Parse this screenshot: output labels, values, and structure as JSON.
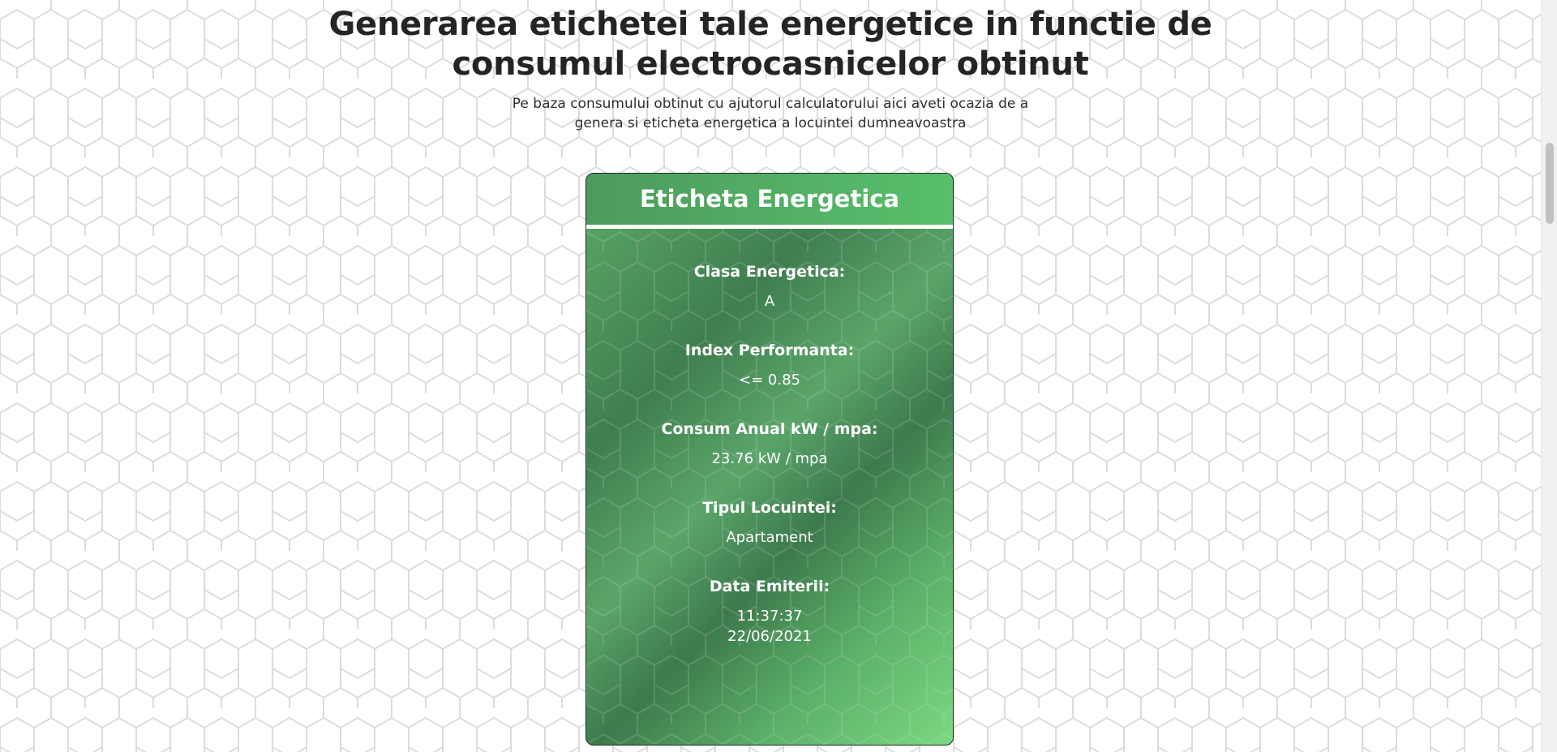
{
  "page": {
    "title": "Generarea etichetei tale energetice in functie de consumul electrocasnicelor obtinut",
    "subtitle": "Pe baza consumului obtinut cu ajutorul calculatorului aici aveti ocazia de a genera si eticheta energetica a locuintei dumneavoastra"
  },
  "label": {
    "heading": "Eticheta Energetica",
    "fields": [
      {
        "label": "Clasa Energetica:",
        "value": "A"
      },
      {
        "label": "Index Performanta:",
        "value": "<= 0.85"
      },
      {
        "label": "Consum Anual kW / mpa:",
        "value": "23.76 kW / mpa"
      },
      {
        "label": "Tipul Locuintei:",
        "value": "Apartament"
      },
      {
        "label": "Data Emiterii:",
        "value_time": "11:37:37",
        "value_date": "22/06/2021"
      }
    ]
  },
  "colors": {
    "accent_green": "#57c06a",
    "dark_green": "#3f7e4e",
    "text_dark": "#242424"
  },
  "icons": {
    "background_pattern": "hexagon-pattern-icon"
  }
}
